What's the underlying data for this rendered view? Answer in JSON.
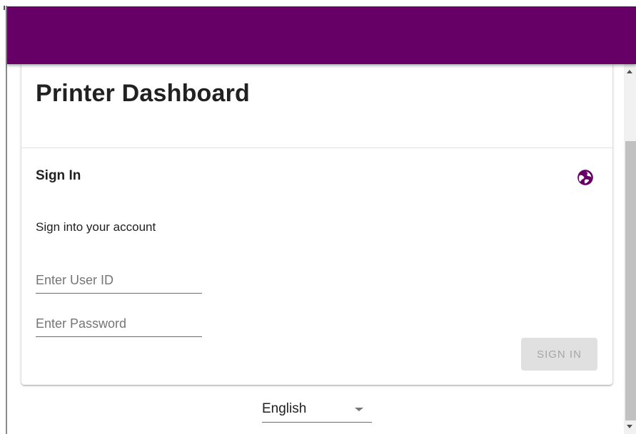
{
  "app_bar": {
    "color": "#660066"
  },
  "card": {
    "title": "Printer Dashboard",
    "signin": {
      "heading": "Sign In",
      "language_icon": "globe-icon",
      "subtitle": "Sign into your account",
      "user_id": {
        "value": "",
        "placeholder": "Enter User ID"
      },
      "password": {
        "value": "",
        "placeholder": "Enter Password"
      },
      "button_label": "SIGN IN",
      "button_disabled": true
    }
  },
  "language_select": {
    "selected": "English"
  },
  "colors": {
    "accent": "#660066",
    "text": "#212121",
    "button_disabled_bg": "#e0e0e0",
    "button_disabled_text": "#a6a6a6"
  }
}
